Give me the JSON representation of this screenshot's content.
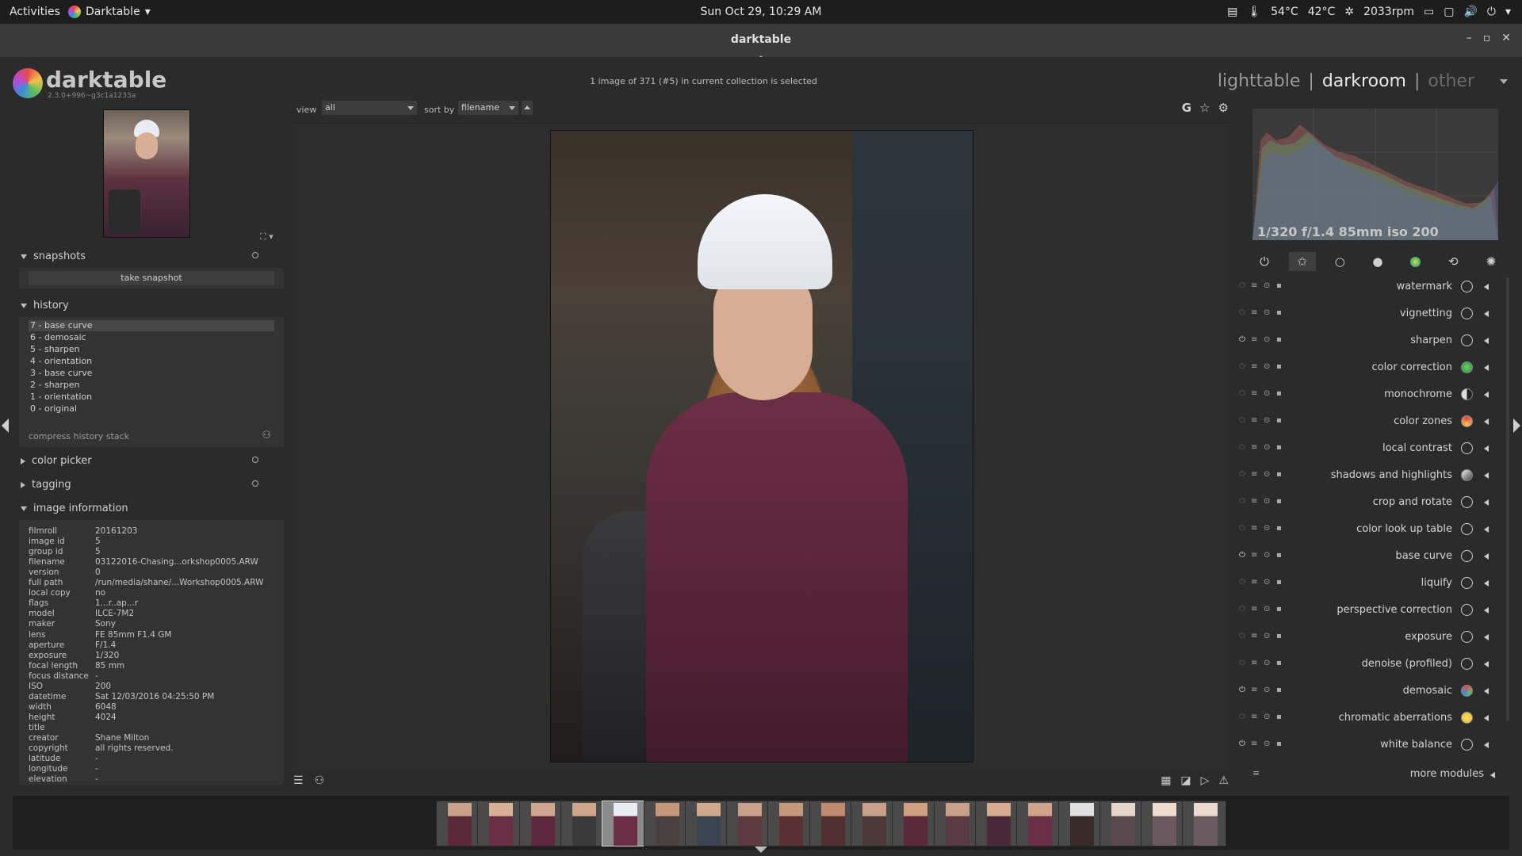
{
  "topbar": {
    "activities": "Activities",
    "app": "Darktable",
    "clock": "Sun Oct 29, 10:29 AM",
    "cpu_temp": "54°C",
    "gpu_temp": "42°C",
    "fan": "2033rpm"
  },
  "window": {
    "title": "darktable"
  },
  "header": {
    "app_name": "darktable",
    "version": "2.3.0+996~g3c1a1233a",
    "collection_info": "1 image of 371 (#5) in current collection is selected",
    "views": [
      "lighttable",
      "|",
      "darkroom",
      "|",
      "other"
    ]
  },
  "toolbar": {
    "view_label": "view",
    "view_value": "all",
    "sort_label": "sort by",
    "sort_value": "filename",
    "icons": [
      "G",
      "☆",
      "⚙"
    ]
  },
  "left": {
    "snapshots": {
      "title": "snapshots",
      "button": "take snapshot"
    },
    "history": {
      "title": "history",
      "items": [
        "7 - base curve",
        "6 - demosaic",
        "5 - sharpen",
        "4 - orientation",
        "3 - base curve",
        "2 - sharpen",
        "1 - orientation",
        "0 - original"
      ],
      "compress": "compress history stack"
    },
    "color_picker": "color picker",
    "tagging": "tagging",
    "image_information": {
      "title": "image information",
      "rows": [
        {
          "k": "filmroll",
          "v": "20161203"
        },
        {
          "k": "image id",
          "v": "5"
        },
        {
          "k": "group id",
          "v": "5"
        },
        {
          "k": "filename",
          "v": "03122016-Chasing...orkshop0005.ARW"
        },
        {
          "k": "version",
          "v": "0"
        },
        {
          "k": "full path",
          "v": "/run/media/shane/...Workshop0005.ARW"
        },
        {
          "k": "local copy",
          "v": "no"
        },
        {
          "k": "flags",
          "v": "1...r..ap...r"
        },
        {
          "k": "model",
          "v": "ILCE-7M2"
        },
        {
          "k": "maker",
          "v": "Sony"
        },
        {
          "k": "lens",
          "v": "FE 85mm F1.4 GM"
        },
        {
          "k": "aperture",
          "v": "F/1.4"
        },
        {
          "k": "exposure",
          "v": "1/320"
        },
        {
          "k": "focal length",
          "v": "85 mm"
        },
        {
          "k": "focus distance",
          "v": "-"
        },
        {
          "k": "ISO",
          "v": "200"
        },
        {
          "k": "datetime",
          "v": "Sat 12/03/2016 04:25:50 PM"
        },
        {
          "k": "width",
          "v": "6048"
        },
        {
          "k": "height",
          "v": "4024"
        },
        {
          "k": "title",
          "v": ""
        },
        {
          "k": "creator",
          "v": "Shane Milton"
        },
        {
          "k": "copyright",
          "v": "all rights reserved."
        },
        {
          "k": "latitude",
          "v": "-"
        },
        {
          "k": "longitude",
          "v": "-"
        },
        {
          "k": "elevation",
          "v": "-"
        }
      ]
    }
  },
  "right": {
    "exif": "1/320 f/1.4 85mm iso 200",
    "modules": [
      {
        "name": "watermark",
        "on": false
      },
      {
        "name": "vignetting",
        "on": false
      },
      {
        "name": "sharpen",
        "on": true
      },
      {
        "name": "color correction",
        "on": false
      },
      {
        "name": "monochrome",
        "on": false
      },
      {
        "name": "color zones",
        "on": false
      },
      {
        "name": "local contrast",
        "on": false
      },
      {
        "name": "shadows and highlights",
        "on": false
      },
      {
        "name": "crop and rotate",
        "on": false
      },
      {
        "name": "color look up table",
        "on": false
      },
      {
        "name": "base curve",
        "on": true
      },
      {
        "name": "liquify",
        "on": false
      },
      {
        "name": "perspective correction",
        "on": false
      },
      {
        "name": "exposure",
        "on": false
      },
      {
        "name": "denoise (profiled)",
        "on": false
      },
      {
        "name": "demosaic",
        "on": true
      },
      {
        "name": "chromatic aberrations",
        "on": false
      },
      {
        "name": "white balance",
        "on": true
      }
    ],
    "more_modules": "more modules"
  },
  "colors": {
    "accent_bg": "#2b2b2b",
    "panel": "#333333",
    "selected": "#474747"
  }
}
